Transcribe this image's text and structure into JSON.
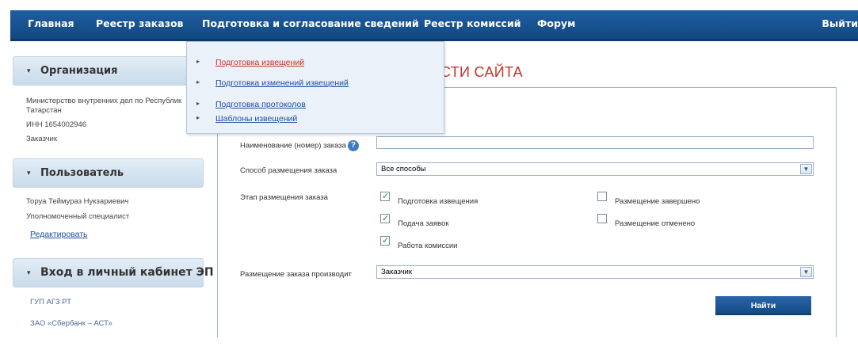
{
  "topnav": {
    "main": "Главная",
    "reestr": "Реестр заказов",
    "podgotovka": "Подготовка и согласование сведений",
    "podgotovka_caret": "⌄",
    "komissii": "Реестр комиссий",
    "forum": "Форум",
    "exit": "Выйти"
  },
  "dropdown": {
    "items": [
      {
        "label": "Подготовка извещений",
        "color": "#c8322c"
      },
      {
        "label": "Подготовка изменений извещений",
        "color": "#1f4fa3"
      },
      {
        "label": "Подготовка протоколов",
        "color": "#1f4fa3"
      },
      {
        "label": "Шаблоны извещений",
        "color": "#1f4fa3"
      }
    ]
  },
  "sidebar": {
    "org": {
      "title": "Организация",
      "line1": "Министерство внутренних дел по Республик",
      "line2": "Татарстан",
      "inn": "ИНН 1654002946",
      "role": "Заказчик"
    },
    "user": {
      "title": "Пользователь",
      "name": "Торуа Теймураз Нукзариевич",
      "position": "Уполномоченный специалист",
      "edit_link": "Редактировать"
    },
    "cabinet": {
      "title": "Вход в личный кабинет ЭП",
      "items": [
        "ГУП АГЗ РТ",
        "ЗАО «Сбербанк – АСТ»"
      ]
    }
  },
  "main": {
    "title_visible": "СТИ САЙТА",
    "form": {
      "name_label": "Наименование (номер) заказа",
      "name_value": "",
      "method_label": "Способ размещения заказа",
      "method_value": "Все способы",
      "stage_label": "Этап размещения заказа",
      "stages": [
        {
          "label": "Подготовка извещения",
          "checked": true
        },
        {
          "label": "Подача заявок",
          "checked": true
        },
        {
          "label": "Работа комиссии",
          "checked": true
        },
        {
          "label": "Размещение завершено",
          "checked": false
        },
        {
          "label": "Размещение отменено",
          "checked": false
        }
      ],
      "producer_label": "Размещение заказа производит",
      "producer_value": "Заказчик",
      "find_button": "Найти"
    }
  },
  "colors": {
    "nav_bg": "#1a5593",
    "accent_red": "#c8322c",
    "link_blue": "#1f4fa3",
    "button_blue": "#134b86"
  }
}
